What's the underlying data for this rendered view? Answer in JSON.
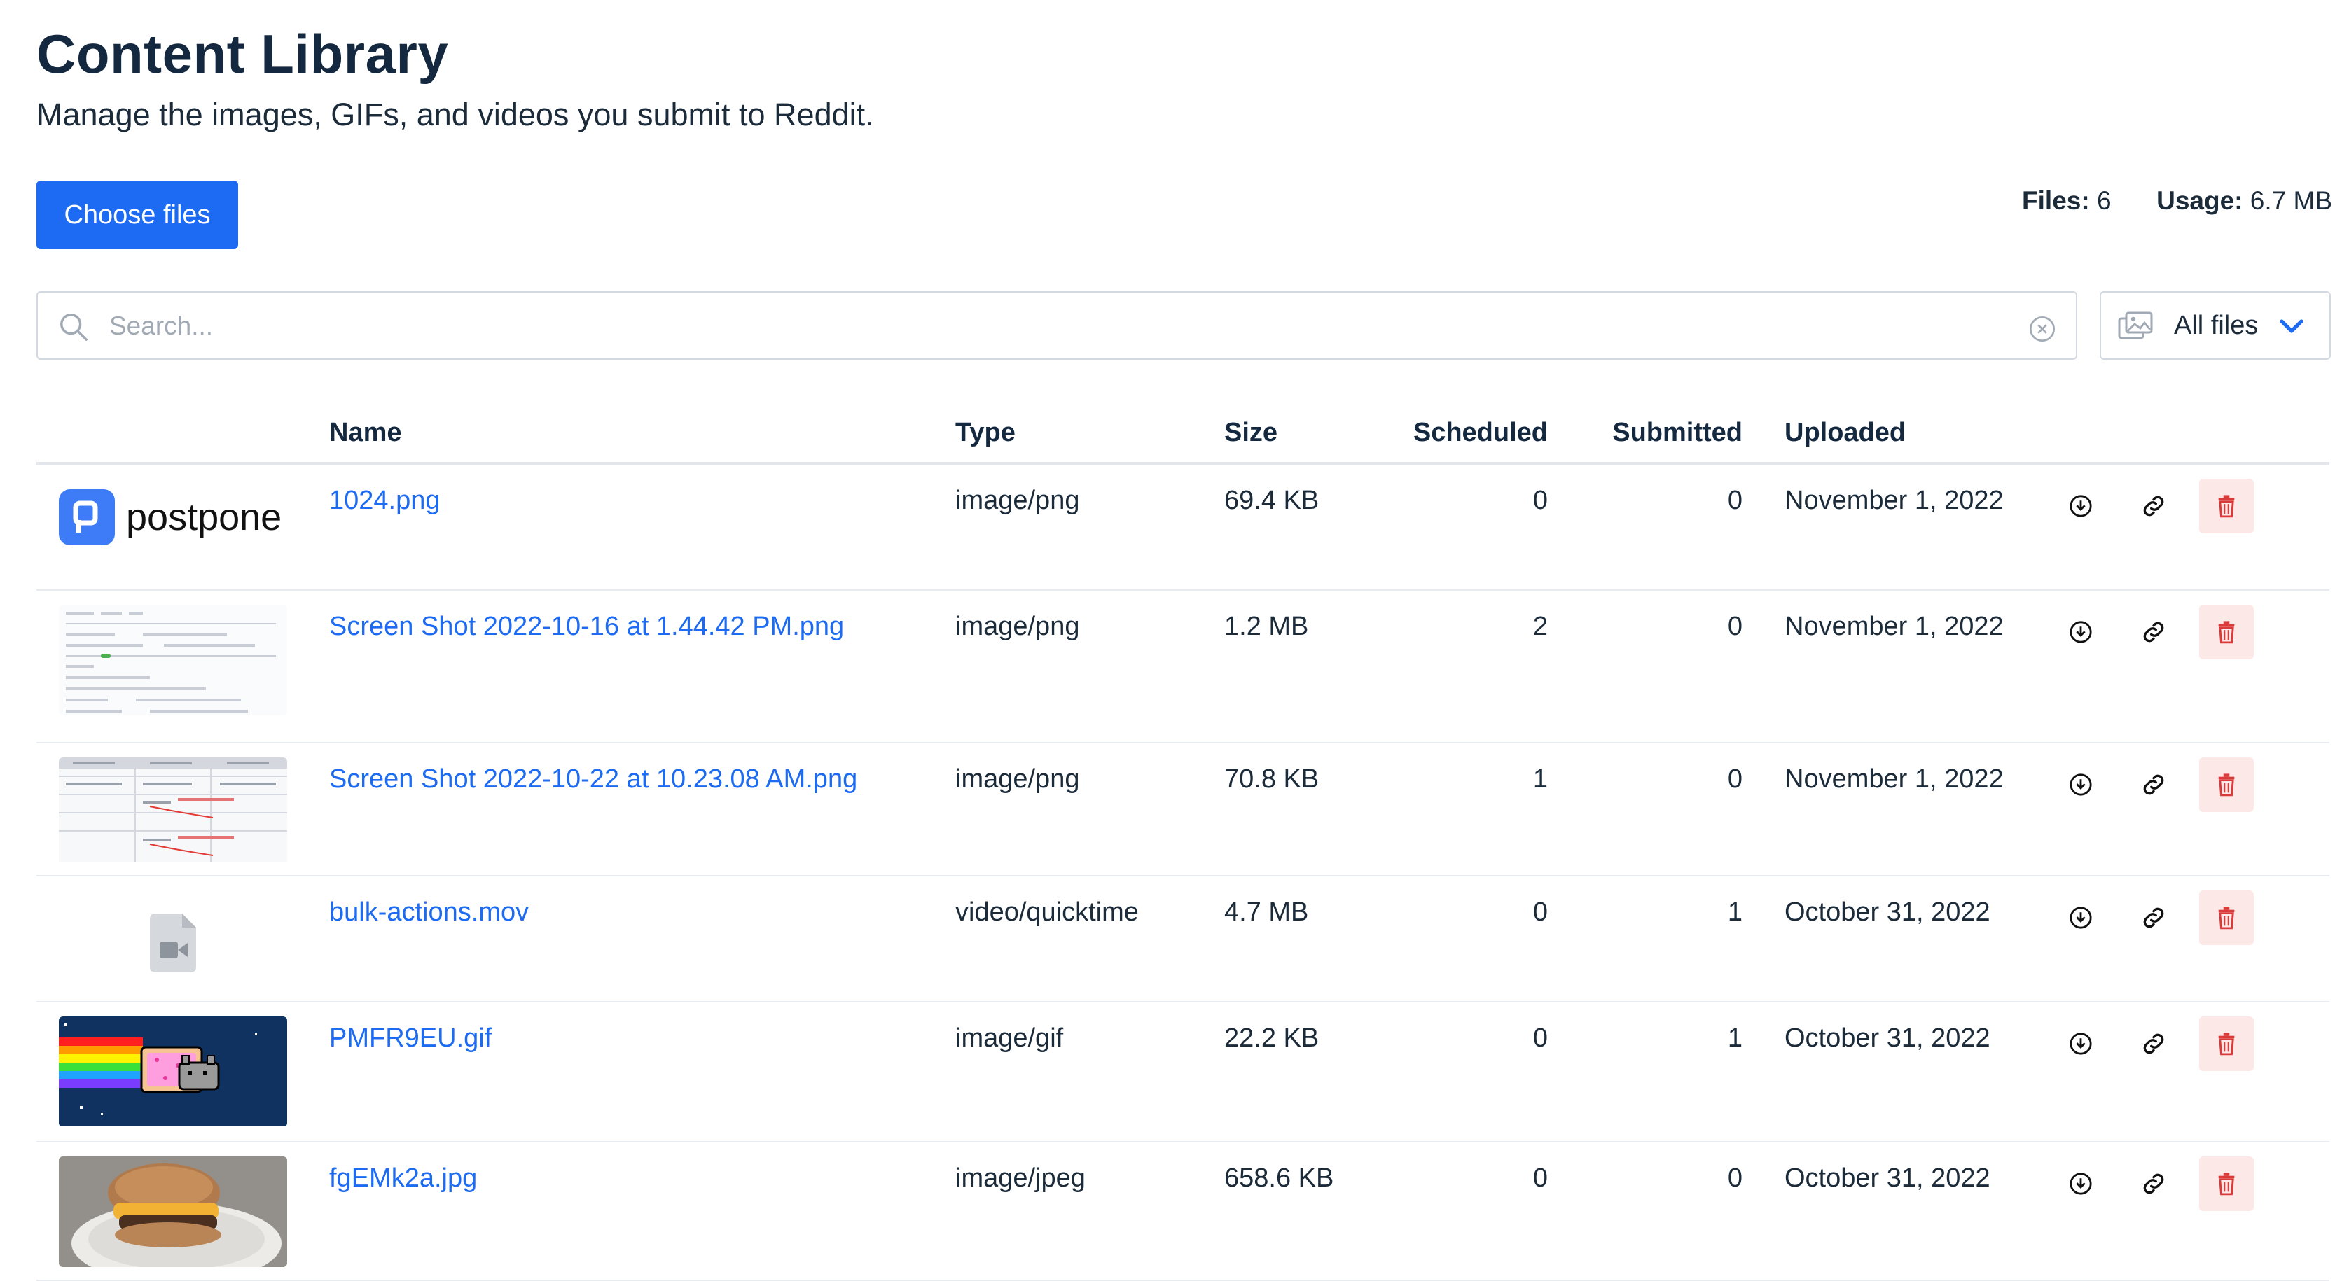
{
  "header": {
    "title": "Content Library",
    "subtitle": "Manage the images, GIFs, and videos you submit to Reddit."
  },
  "upload": {
    "choose_label": "Choose files"
  },
  "stats": {
    "files_label": "Files:",
    "files_value": "6",
    "usage_label": "Usage:",
    "usage_value": "6.7 MB"
  },
  "search": {
    "placeholder": "Search...",
    "value": ""
  },
  "filter": {
    "selected": "All files"
  },
  "table": {
    "columns": {
      "name": "Name",
      "type": "Type",
      "size": "Size",
      "scheduled": "Scheduled",
      "submitted": "Submitted",
      "uploaded": "Uploaded"
    },
    "rows": [
      {
        "thumb": "postpone-logo",
        "thumb_text": "postpone",
        "name": "1024.png",
        "type": "image/png",
        "size": "69.4 KB",
        "scheduled": "0",
        "submitted": "0",
        "uploaded": "November 1, 2022"
      },
      {
        "thumb": "screenshot",
        "name": "Screen Shot 2022-10-16 at 1.44.42 PM.png",
        "type": "image/png",
        "size": "1.2 MB",
        "scheduled": "2",
        "submitted": "0",
        "uploaded": "November 1, 2022"
      },
      {
        "thumb": "screenshot-table",
        "name": "Screen Shot 2022-10-22 at 10.23.08 AM.png",
        "type": "image/png",
        "size": "70.8 KB",
        "scheduled": "1",
        "submitted": "0",
        "uploaded": "November 1, 2022"
      },
      {
        "thumb": "video-file-icon",
        "name": "bulk-actions.mov",
        "type": "video/quicktime",
        "size": "4.7 MB",
        "scheduled": "0",
        "submitted": "1",
        "uploaded": "October 31, 2022"
      },
      {
        "thumb": "nyan-cat-gif",
        "name": "PMFR9EU.gif",
        "type": "image/gif",
        "size": "22.2 KB",
        "scheduled": "0",
        "submitted": "1",
        "uploaded": "October 31, 2022"
      },
      {
        "thumb": "sandwich-photo",
        "name": "fgEMk2a.jpg",
        "type": "image/jpeg",
        "size": "658.6 KB",
        "scheduled": "0",
        "submitted": "0",
        "uploaded": "October 31, 2022"
      }
    ]
  },
  "colors": {
    "accent": "#1c6bf2",
    "delete_bg": "#fde8e8",
    "delete_icon": "#d93a3a",
    "title": "#14283f"
  }
}
